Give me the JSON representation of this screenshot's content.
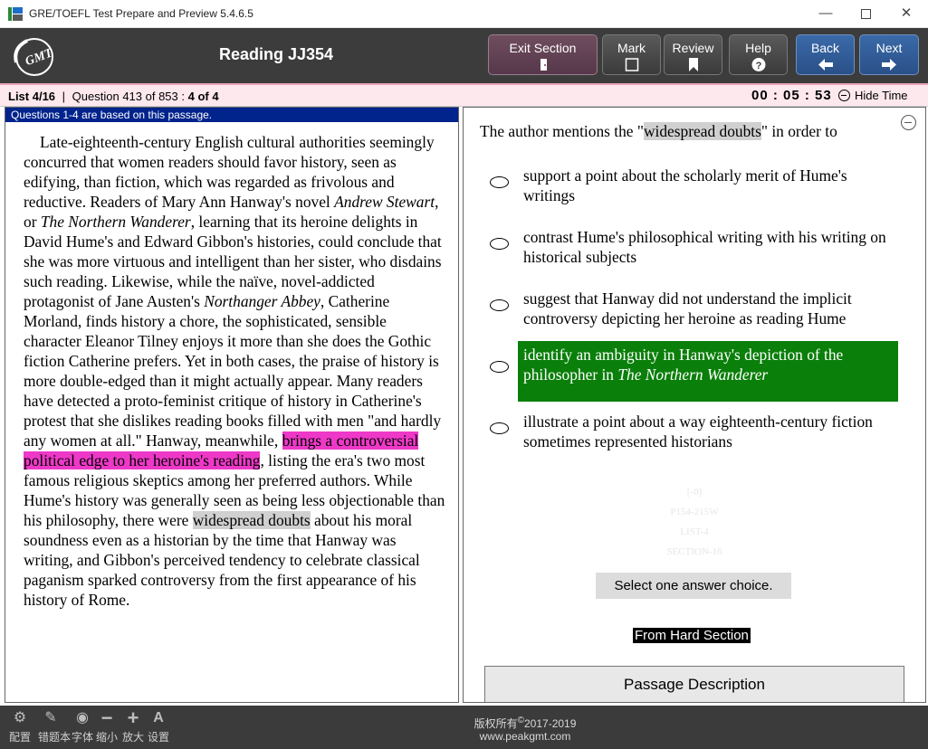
{
  "window": {
    "title": "GRE/TOEFL Test Prepare and Preview 5.4.6.5",
    "minimize_glyph": "—",
    "close_glyph": "✕"
  },
  "toolbar": {
    "logo_text": "GMT",
    "section_title": "Reading JJ354",
    "buttons": {
      "exit": "Exit Section",
      "mark": "Mark",
      "review": "Review",
      "help": "Help",
      "back": "Back",
      "next": "Next"
    }
  },
  "status": {
    "list": "List 4/16",
    "question_prefix": "Question 413 of 853 :",
    "question_pos": "4 of 4",
    "timer": "00 : 05 : 53",
    "hide_time": "Hide Time"
  },
  "passage": {
    "header": "Questions 1-4 are based on this passage.",
    "seg1": "Late-eighteenth-century English cultural authorities seemingly concurred that women readers should favor history, seen as edifying, than fiction, which was regarded as frivolous and reductive. Readers of Mary Ann Hanway's novel ",
    "italic1": "Andrew Stewart",
    "seg2": ", or ",
    "italic2": "The Northern Wanderer",
    "seg3": ", learning that its heroine delights in David Hume's and Edward Gibbon's histories, could conclude that she was more virtuous and intelligent than her sister, who disdains such reading. Likewise, while the naïve, novel-addicted protagonist of Jane Austen's ",
    "italic3": "Northanger Abbey",
    "seg4": ", Catherine Morland, finds history a chore, the sophisticated, sensible character Eleanor Tilney enjoys it more than she does the Gothic fiction Catherine prefers. Yet in both cases, the praise of history is more double-edged than it might actually appear. Many readers have detected a proto-feminist critique of history in Catherine's protest that she dislikes reading books filled with men \"and hardly any women at all.\" Hanway, meanwhile, ",
    "highlight_pink": "brings a controversial political edge to her heroine's reading",
    "seg5": ", listing the era's two most famous religious skeptics among her preferred authors. While Hume's history was generally seen as being less objectionable than his philosophy, there were ",
    "highlight_gray": "widespread doubts",
    "seg6": " about his moral soundness even as a historian by the time that Hanway was writing, and Gibbon's perceived tendency to celebrate classical paganism sparked controversy from the first appearance of his history of Rome."
  },
  "question": {
    "stem_pre": "The author mentions the \"",
    "stem_hl": "widespread doubts",
    "stem_post": "\" in order to",
    "choices": [
      {
        "text": "support a point about the scholarly merit of Hume's writings"
      },
      {
        "text": "contrast Hume's philosophical writing with his writing on historical subjects"
      },
      {
        "text": "suggest that Hanway did not understand the implicit controversy depicting her heroine as reading Hume"
      },
      {
        "text_pre": "identify an ambiguity in Hanway's depiction of the philosopher in ",
        "text_italic": "The Northern Wanderer",
        "selected": true
      },
      {
        "text": "illustrate a point about a way eighteenth-century fiction sometimes represented historians"
      }
    ],
    "watermark": [
      "[-0]",
      "P154-215W",
      "LIST-4",
      "SECTION-16"
    ],
    "instruction": "Select one answer choice.",
    "hard_section": "From Hard Section",
    "passage_description": "Passage Description"
  },
  "bottombar": {
    "tools": [
      {
        "label": "配置",
        "icon": "gear-icon"
      },
      {
        "label": "错题本",
        "icon": "notebook-icon"
      },
      {
        "label": "字体",
        "icon": "font-icon"
      },
      {
        "label": "缩小",
        "icon": "zoom-out-icon"
      },
      {
        "label": "放大",
        "icon": "zoom-in-icon"
      },
      {
        "label": "设置",
        "icon": "settings-icon"
      }
    ],
    "copyright_line1": "版权所有",
    "copyright_mark": "©",
    "copyright_years": "2017-2019",
    "copyright_line2": "www.peakgmt.com"
  },
  "colors": {
    "toolbar_bg": "#3c3c3c",
    "exit_btn": "#6e4d5e",
    "nav_btn": "#3a6aa8",
    "passage_header": "#00238c",
    "highlight_pink": "#ee38c8",
    "selected_choice": "#0a7f0a"
  }
}
